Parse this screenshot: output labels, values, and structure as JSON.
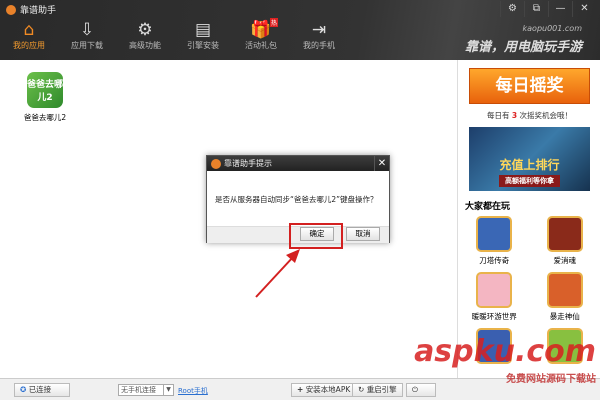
{
  "title": "靠谱助手",
  "window_controls": [
    "⚙",
    "⧉",
    "—",
    "✕"
  ],
  "nav": [
    {
      "label": "我的应用",
      "icon": "home-icon",
      "glyph": "⌂",
      "active": true
    },
    {
      "label": "应用下载",
      "icon": "download-box-icon",
      "glyph": "⇩"
    },
    {
      "label": "高级功能",
      "icon": "gears-icon",
      "glyph": "⚙"
    },
    {
      "label": "引擎安装",
      "icon": "drive-icon",
      "glyph": "▤"
    },
    {
      "label": "活动礼包",
      "icon": "gift-icon",
      "glyph": "🎁",
      "badge": "热"
    },
    {
      "label": "我的手机",
      "icon": "phone-exit-icon",
      "glyph": "⇥"
    }
  ],
  "slogan": {
    "url": "kaopu001.com",
    "text": "靠谱，用电脑玩手游"
  },
  "apps": [
    {
      "name": "爸爸去哪儿2",
      "icon_text": "爸爸去哪儿2"
    }
  ],
  "side": {
    "lottery": "每日摇奖",
    "note_pre": "每日有",
    "note_count": "3",
    "note_post": "次摇奖机会哦！",
    "banner_title": "充值上排行",
    "banner_sub": "高额福利等你拿",
    "popular": "大家都在玩",
    "games": [
      {
        "name": "刀塔传奇",
        "color": "#3a67b5"
      },
      {
        "name": "爱消魂",
        "color": "#8a2a1a"
      },
      {
        "name": "暖暖环游世界",
        "color": "#f4b6c2"
      },
      {
        "name": "暴走神仙",
        "color": "#d9602a"
      },
      {
        "name": "",
        "color": "#3a5fb0"
      },
      {
        "name": "",
        "color": "#88c040"
      }
    ]
  },
  "status": {
    "connected": "已连接",
    "phone_select": "无手机连接",
    "root_link": "Root手机",
    "install_apk": "安装本地APK",
    "restart": "重启引擎",
    "power": "⏻"
  },
  "dialog": {
    "title": "靠谱助手提示",
    "message": "是否从服务器自动同步“爸爸去哪儿2”键盘操作？",
    "ok": "确定",
    "cancel": "取消"
  },
  "watermark": {
    "main": "aspku.com",
    "sub": "免费网站源码下载站"
  },
  "accent": "#f08a24"
}
